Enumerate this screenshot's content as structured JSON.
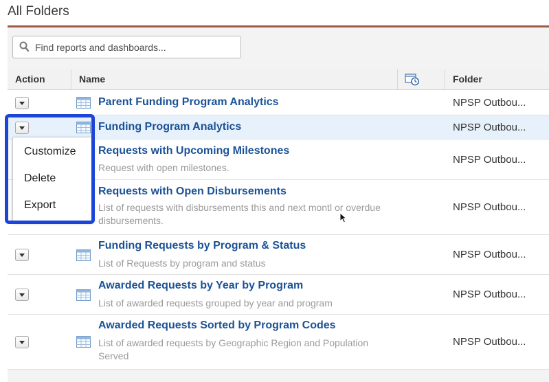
{
  "page": {
    "title": "All Folders"
  },
  "search": {
    "placeholder": "Find reports and dashboards..."
  },
  "table": {
    "headers": {
      "action": "Action",
      "name": "Name",
      "folder": "Folder",
      "schedule_icon": "scheduled-clock-icon"
    },
    "rows": [
      {
        "title": "Parent Funding Program Analytics",
        "desc": "",
        "folder": "NPSP Outbou..."
      },
      {
        "title": "Funding Program Analytics",
        "desc": "",
        "folder": "NPSP Outbou...",
        "selected": true
      },
      {
        "title": "Requests with Upcoming Milestones",
        "desc": "Request with open milestones.",
        "folder": "NPSP Outbou..."
      },
      {
        "title": "Requests with Open Disbursements",
        "desc": "List of requests with disbursements this and next montl or overdue disbursements.",
        "folder": "NPSP Outbou..."
      },
      {
        "title": "Funding Requests by Program & Status",
        "desc": "List of Requests by program and status",
        "folder": "NPSP Outbou..."
      },
      {
        "title": "Awarded Requests by Year by Program",
        "desc": "List of awarded requests grouped by year and program",
        "folder": "NPSP Outbou..."
      },
      {
        "title": "Awarded Requests Sorted by Program Codes",
        "desc": "List of awarded requests by Geographic Region and Population Served",
        "folder": "NPSP Outbou..."
      }
    ]
  },
  "action_menu": {
    "items": [
      "Customize",
      "Delete",
      "Export"
    ]
  },
  "colors": {
    "link": "#1b5297",
    "highlight": "#1d44d9",
    "accent_rule": "#9c5a48",
    "selected_row": "#e6f1fb"
  }
}
